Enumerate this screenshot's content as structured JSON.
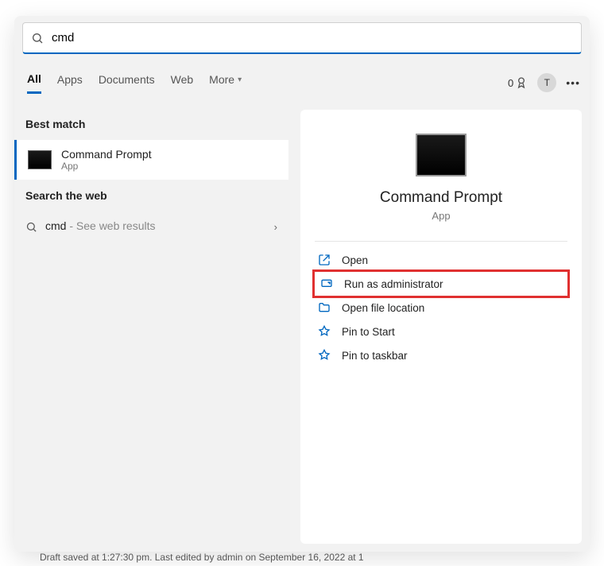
{
  "search": {
    "value": "cmd"
  },
  "tabs": {
    "items": [
      "All",
      "Apps",
      "Documents",
      "Web",
      "More"
    ],
    "active": 0
  },
  "header": {
    "badge_count": "0",
    "avatar_initial": "T"
  },
  "left": {
    "section_best": "Best match",
    "result": {
      "title": "Command Prompt",
      "subtitle": "App"
    },
    "section_web": "Search the web",
    "web": {
      "query": "cmd",
      "suffix": " - See web results"
    }
  },
  "details": {
    "title": "Command Prompt",
    "subtitle": "App",
    "actions": [
      {
        "label": "Open",
        "icon": "open"
      },
      {
        "label": "Run as administrator",
        "icon": "admin",
        "highlight": true
      },
      {
        "label": "Open file location",
        "icon": "folder"
      },
      {
        "label": "Pin to Start",
        "icon": "pin"
      },
      {
        "label": "Pin to taskbar",
        "icon": "pin"
      }
    ]
  },
  "footer": "Draft saved at 1:27:30 pm. Last edited by admin on September 16, 2022 at 1"
}
